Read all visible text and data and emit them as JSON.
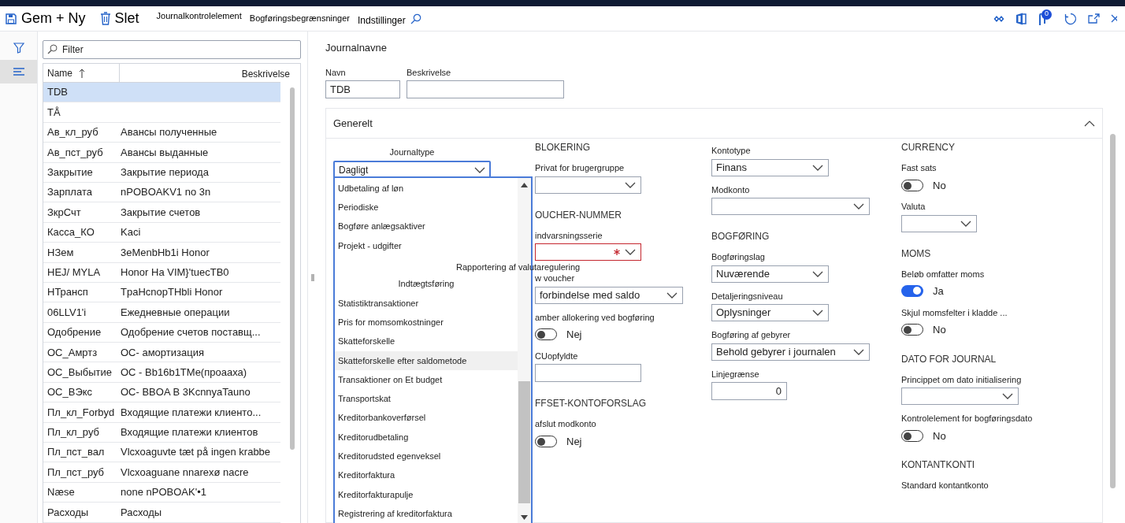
{
  "toolbar": {
    "actions": [
      {
        "label": "Gem + Ny"
      },
      {
        "label": "Slet"
      }
    ],
    "tabs": [
      "Journalkontrolelement",
      "Bogføringsbegrænsninger",
      "Indstillinger"
    ],
    "badge": "0"
  },
  "nav_rail": [
    {
      "selected": false
    },
    {
      "selected": true
    }
  ],
  "list": {
    "filter_placeholder": "Filter",
    "columns": [
      "Name",
      "Beskrivelse"
    ],
    "rows": [
      {
        "name": "TDB",
        "selected": true
      },
      {
        "name": "TÅ",
        "selected": false
      },
      {
        "name": "Ав_кл_руб",
        "description": "Авансы полученные",
        "selected": false
      },
      {
        "name": "Ав_пст_руб",
        "description": "Авансы выданные",
        "selected": false
      },
      {
        "name": "Закрытие",
        "description": "Закрытие периода",
        "selected": false
      },
      {
        "name": "Зарплата",
        "description": "nPOBOAKV1 no 3n",
        "selected": false
      },
      {
        "name": "ЗкрСчт",
        "description": "Закрытие счетов",
        "selected": false
      },
      {
        "name": "Касса_КО",
        "description": "Kaci",
        "selected": false
      },
      {
        "name": "НЗем",
        "description": "3eMenbHb1i Honor",
        "selected": false
      },
      {
        "name": "HEJ/ MYLA",
        "description": "Honor Ha VIM}'tuecTB0",
        "selected": false
      },
      {
        "name": "НТрансп",
        "description": "TpaHcnopTHbli Honor",
        "selected": false
      },
      {
        "name": "06LLV1'i",
        "description": "Ежедневные операции",
        "selected": false
      },
      {
        "name": "Одобрение",
        "description": "Одобрение счетов поставщ...",
        "selected": false
      },
      {
        "name": "ОС_Амртз",
        "description": "ОС-   амортизация",
        "selected": false
      },
      {
        "name": "ОС_Выбытие",
        "description": "OC - Bb16b1TMe(проааха)",
        "selected": false
      },
      {
        "name": "ОС_ВЭкс",
        "description": "ОС-   BBOA B 3KcnnyaTauno",
        "selected": false
      },
      {
        "name": "Пл_кл_Forbyd",
        "description": "Входящие платежи клиенто...",
        "selected": false
      },
      {
        "name": "Пл_кл_руб",
        "description": "Входящие платежи клиентов",
        "selected": false
      },
      {
        "name": "Пл_пст_вал",
        "description": "Vlcxoaguvte tæt på ingen krabbe",
        "selected": false
      },
      {
        "name": "Пл_пст_руб",
        "description": "Vlcxoaguane nnarexø nacre",
        "selected": false
      },
      {
        "name": "Næse",
        "description": "none nPOBOAK'•1",
        "selected": false
      },
      {
        "name": "Расходы",
        "description": "Расходы",
        "selected": false
      }
    ]
  },
  "header": {
    "title": "Journalnavne",
    "fields": [
      {
        "label": "Navn",
        "value": "TDB"
      },
      {
        "label": "Beskrivelse"
      }
    ]
  },
  "section": {
    "title": "Generelt",
    "expanded": true,
    "journaltype": {
      "label": "Journaltype",
      "value": "Dagligt",
      "options": [
        {
          "label": "Udbetaling af løn",
          "kind": "plain",
          "highlighted": false
        },
        {
          "label": "Periodiske",
          "kind": "plain",
          "highlighted": false
        },
        {
          "label": "Bogføre anlægsaktiver",
          "kind": "plain",
          "highlighted": false
        },
        {
          "label": "Projekt - udgifter",
          "kind": "plain",
          "highlighted": false
        },
        {
          "label": "Rapportering af valutaregulering",
          "kind": "overflow",
          "highlighted": false
        },
        {
          "label": "Indtægtsføring",
          "kind": "centered",
          "highlighted": false
        },
        {
          "label": "Statistiktransaktioner",
          "kind": "plain",
          "highlighted": false
        },
        {
          "label": "Pris for momsomkostninger",
          "kind": "plain",
          "highlighted": false
        },
        {
          "label": "Skatteforskelle",
          "kind": "plain",
          "highlighted": false
        },
        {
          "label": "Skatteforskelle efter saldometode",
          "kind": "plain",
          "highlighted": true
        },
        {
          "label": "Transaktioner on Et budget",
          "kind": "plain",
          "highlighted": false
        },
        {
          "label": "Transportskat",
          "kind": "plain",
          "highlighted": false
        },
        {
          "label": "Kreditorbankoverførsel",
          "kind": "plain",
          "highlighted": false
        },
        {
          "label": "Kreditorudbetaling",
          "kind": "plain",
          "highlighted": false
        },
        {
          "label": "Kreditorudsted egenveksel",
          "kind": "plain",
          "highlighted": false
        },
        {
          "label": "Kreditorfaktura",
          "kind": "plain",
          "highlighted": false
        },
        {
          "label": "Kreditorfakturapulje",
          "kind": "plain",
          "highlighted": false
        },
        {
          "label": "Registrering af kreditorfaktura",
          "kind": "plain",
          "highlighted": false
        }
      ]
    },
    "columns": [
      [
        {
          "kind": "heading",
          "label": "BLOKERING"
        },
        {
          "kind": "select",
          "label": "Privat for brugergruppe",
          "wide": false
        },
        {
          "kind": "heading",
          "label": "OUCHER-NUMMER"
        },
        {
          "kind": "select",
          "label": "indvarsningsserie",
          "required": true,
          "wide": false
        },
        {
          "kind": "select",
          "label": "w voucher",
          "value": "forbindelse med saldo",
          "wide": true
        },
        {
          "kind": "toggle",
          "label": "amber allokering ved bogføring",
          "on": false,
          "value": "Nej"
        },
        {
          "kind": "input",
          "label": "CUopfyldte",
          "wide": false
        },
        {
          "kind": "heading",
          "label": "FFSET-KONTOFORSLAG"
        },
        {
          "kind": "toggle",
          "label": "afslut modkonto",
          "on": false,
          "value": "Nej"
        }
      ],
      [
        {
          "kind": "select",
          "label": "Kontotype",
          "value": "Finans",
          "wide": false
        },
        {
          "kind": "select",
          "label": "Modkonto",
          "wide": true
        },
        {
          "kind": "heading",
          "label": "BOGFØRING"
        },
        {
          "kind": "select",
          "label": "Bogføringslag",
          "value": "Nuværende",
          "wide": false
        },
        {
          "kind": "select",
          "label": "Detaljeringsniveau",
          "value": "Oplysninger",
          "wide": false
        },
        {
          "kind": "select",
          "label": "Bogføring af gebyrer",
          "value": "Behold gebyrer i journalen",
          "wide": true
        },
        {
          "kind": "number",
          "label": "Linjegrænse",
          "value": "0"
        }
      ],
      [
        {
          "kind": "heading",
          "label": "CURRENCY"
        },
        {
          "kind": "toggle",
          "label": "Fast sats",
          "on": false,
          "value": "No"
        },
        {
          "kind": "select",
          "label": "Valuta",
          "wide": false
        },
        {
          "kind": "heading",
          "label": "MOMS"
        },
        {
          "kind": "toggle",
          "label": "Beløb omfatter moms",
          "on": true,
          "value": "Ja"
        },
        {
          "kind": "toggle",
          "label": "Skjul momsfelter i kladde ...",
          "on": false,
          "value": "No"
        },
        {
          "kind": "heading",
          "label": "DATO FOR JOURNAL"
        },
        {
          "kind": "select",
          "label": "Princippet om dato initialisering",
          "wide": true
        },
        {
          "kind": "toggle",
          "label": "Kontrolelement for bogføringsdato",
          "on": false,
          "value": "No"
        },
        {
          "kind": "heading",
          "label": "KONTANTKONTI"
        },
        {
          "kind": "label",
          "label": "Standard kontantkonto"
        }
      ]
    ]
  }
}
